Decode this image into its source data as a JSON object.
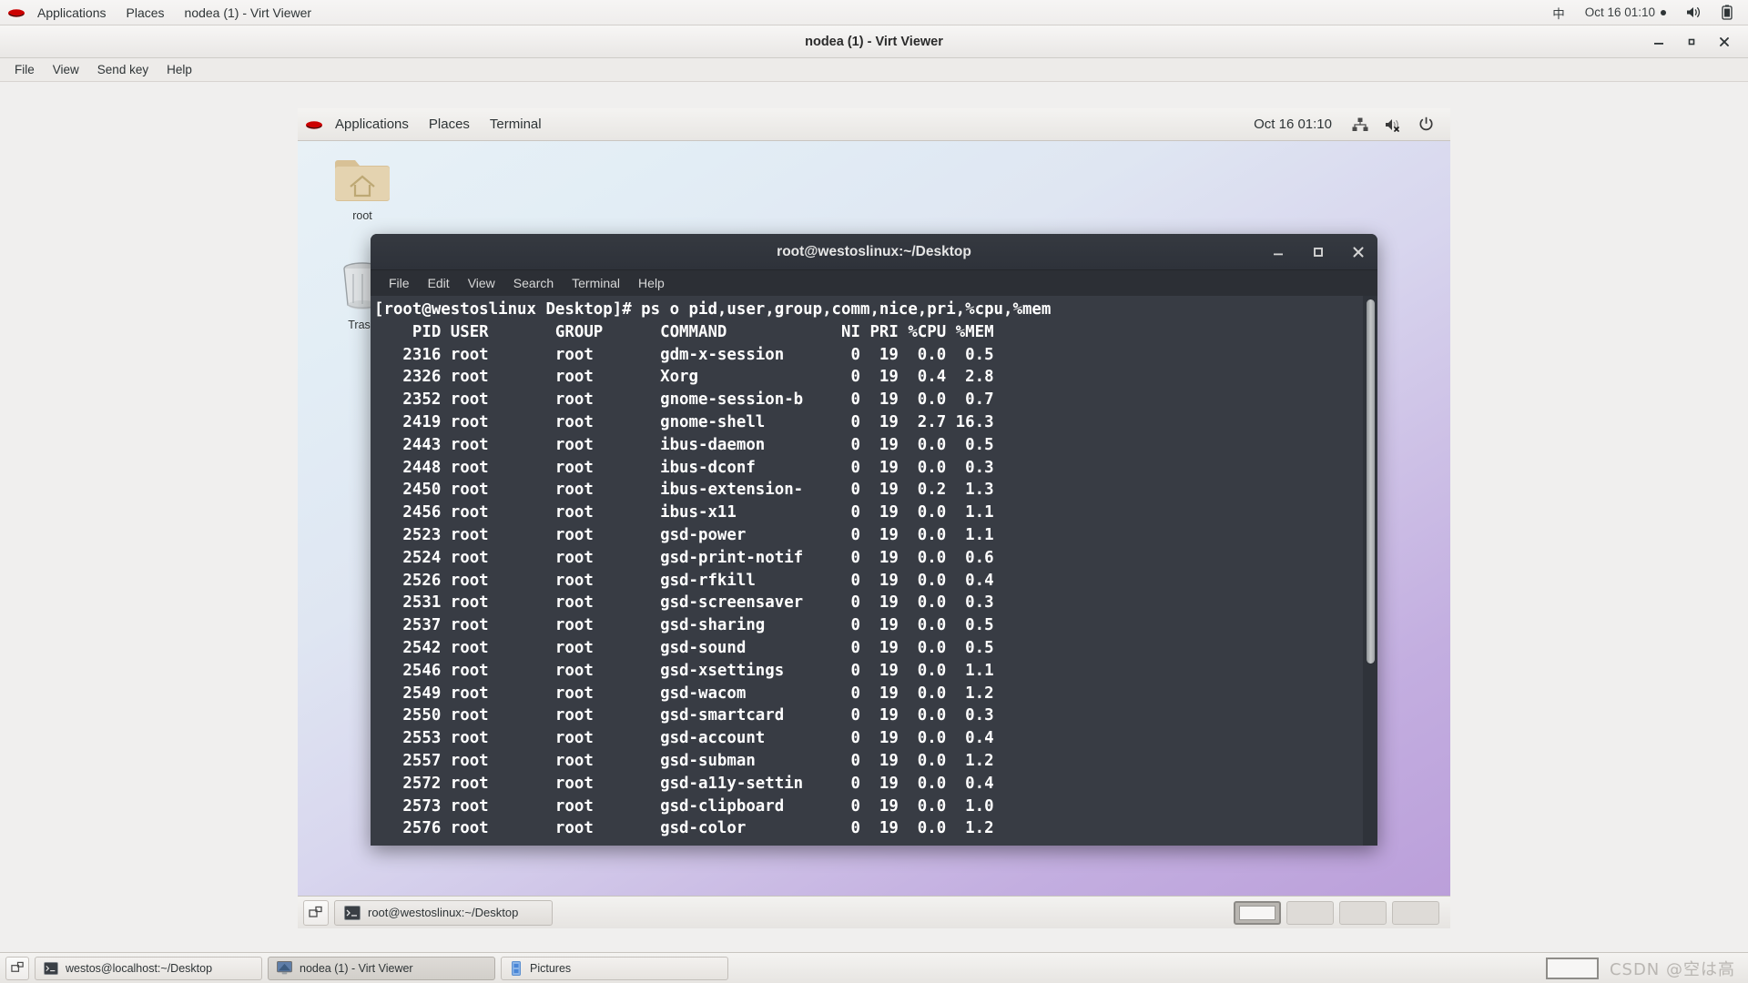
{
  "host_panel": {
    "logo": "redhat-logo",
    "menus": [
      {
        "label": "Applications"
      },
      {
        "label": "Places"
      },
      {
        "label": "nodea (1) - Virt Viewer"
      }
    ],
    "input_method": "中",
    "clock": "Oct 16  01:10",
    "volume_icon": "volume-icon",
    "battery_icon": "battery-icon"
  },
  "virt_viewer": {
    "title": "nodea (1) - Virt Viewer",
    "menus": [
      {
        "label": "File"
      },
      {
        "label": "View"
      },
      {
        "label": "Send key"
      },
      {
        "label": "Help"
      }
    ],
    "window_controls": {
      "minimize": "minimize-icon",
      "maximize": "maximize-icon",
      "close": "close-icon"
    }
  },
  "vm_panel": {
    "logo": "redhat-logo",
    "menus": [
      {
        "label": "Applications"
      },
      {
        "label": "Places"
      },
      {
        "label": "Terminal"
      }
    ],
    "clock": "Oct 16  01:10",
    "network_icon": "network-icon",
    "volume_icon": "volume-muted-icon",
    "power_icon": "power-icon"
  },
  "desktop_icons": [
    {
      "label": "root",
      "icon": "home-folder-icon"
    },
    {
      "label": "Trash",
      "icon": "trash-icon"
    }
  ],
  "terminal": {
    "title": "root@westoslinux:~/Desktop",
    "menus": [
      {
        "label": "File"
      },
      {
        "label": "Edit"
      },
      {
        "label": "View"
      },
      {
        "label": "Search"
      },
      {
        "label": "Terminal"
      },
      {
        "label": "Help"
      }
    ],
    "window_controls": {
      "minimize": "minimize-icon",
      "maximize": "maximize-icon",
      "close": "close-icon"
    },
    "prompt": "[root@westoslinux Desktop]#",
    "command": "ps o pid,user,group,comm,nice,pri,%cpu,%mem",
    "columns": [
      "PID",
      "USER",
      "GROUP",
      "COMMAND",
      "NI",
      "PRI",
      "%CPU",
      "%MEM"
    ],
    "rows": [
      {
        "pid": "2316",
        "user": "root",
        "group": "root",
        "command": "gdm-x-session",
        "ni": "0",
        "pri": "19",
        "cpu": "0.0",
        "mem": "0.5"
      },
      {
        "pid": "2326",
        "user": "root",
        "group": "root",
        "command": "Xorg",
        "ni": "0",
        "pri": "19",
        "cpu": "0.4",
        "mem": "2.8"
      },
      {
        "pid": "2352",
        "user": "root",
        "group": "root",
        "command": "gnome-session-b",
        "ni": "0",
        "pri": "19",
        "cpu": "0.0",
        "mem": "0.7"
      },
      {
        "pid": "2419",
        "user": "root",
        "group": "root",
        "command": "gnome-shell",
        "ni": "0",
        "pri": "19",
        "cpu": "2.7",
        "mem": "16.3"
      },
      {
        "pid": "2443",
        "user": "root",
        "group": "root",
        "command": "ibus-daemon",
        "ni": "0",
        "pri": "19",
        "cpu": "0.0",
        "mem": "0.5"
      },
      {
        "pid": "2448",
        "user": "root",
        "group": "root",
        "command": "ibus-dconf",
        "ni": "0",
        "pri": "19",
        "cpu": "0.0",
        "mem": "0.3"
      },
      {
        "pid": "2450",
        "user": "root",
        "group": "root",
        "command": "ibus-extension-",
        "ni": "0",
        "pri": "19",
        "cpu": "0.2",
        "mem": "1.3"
      },
      {
        "pid": "2456",
        "user": "root",
        "group": "root",
        "command": "ibus-x11",
        "ni": "0",
        "pri": "19",
        "cpu": "0.0",
        "mem": "1.1"
      },
      {
        "pid": "2523",
        "user": "root",
        "group": "root",
        "command": "gsd-power",
        "ni": "0",
        "pri": "19",
        "cpu": "0.0",
        "mem": "1.1"
      },
      {
        "pid": "2524",
        "user": "root",
        "group": "root",
        "command": "gsd-print-notif",
        "ni": "0",
        "pri": "19",
        "cpu": "0.0",
        "mem": "0.6"
      },
      {
        "pid": "2526",
        "user": "root",
        "group": "root",
        "command": "gsd-rfkill",
        "ni": "0",
        "pri": "19",
        "cpu": "0.0",
        "mem": "0.4"
      },
      {
        "pid": "2531",
        "user": "root",
        "group": "root",
        "command": "gsd-screensaver",
        "ni": "0",
        "pri": "19",
        "cpu": "0.0",
        "mem": "0.3"
      },
      {
        "pid": "2537",
        "user": "root",
        "group": "root",
        "command": "gsd-sharing",
        "ni": "0",
        "pri": "19",
        "cpu": "0.0",
        "mem": "0.5"
      },
      {
        "pid": "2542",
        "user": "root",
        "group": "root",
        "command": "gsd-sound",
        "ni": "0",
        "pri": "19",
        "cpu": "0.0",
        "mem": "0.5"
      },
      {
        "pid": "2546",
        "user": "root",
        "group": "root",
        "command": "gsd-xsettings",
        "ni": "0",
        "pri": "19",
        "cpu": "0.0",
        "mem": "1.1"
      },
      {
        "pid": "2549",
        "user": "root",
        "group": "root",
        "command": "gsd-wacom",
        "ni": "0",
        "pri": "19",
        "cpu": "0.0",
        "mem": "1.2"
      },
      {
        "pid": "2550",
        "user": "root",
        "group": "root",
        "command": "gsd-smartcard",
        "ni": "0",
        "pri": "19",
        "cpu": "0.0",
        "mem": "0.3"
      },
      {
        "pid": "2553",
        "user": "root",
        "group": "root",
        "command": "gsd-account",
        "ni": "0",
        "pri": "19",
        "cpu": "0.0",
        "mem": "0.4"
      },
      {
        "pid": "2557",
        "user": "root",
        "group": "root",
        "command": "gsd-subman",
        "ni": "0",
        "pri": "19",
        "cpu": "0.0",
        "mem": "1.2"
      },
      {
        "pid": "2572",
        "user": "root",
        "group": "root",
        "command": "gsd-a11y-settin",
        "ni": "0",
        "pri": "19",
        "cpu": "0.0",
        "mem": "0.4"
      },
      {
        "pid": "2573",
        "user": "root",
        "group": "root",
        "command": "gsd-clipboard",
        "ni": "0",
        "pri": "19",
        "cpu": "0.0",
        "mem": "1.0"
      },
      {
        "pid": "2576",
        "user": "root",
        "group": "root",
        "command": "gsd-color",
        "ni": "0",
        "pri": "19",
        "cpu": "0.0",
        "mem": "1.2"
      }
    ]
  },
  "vm_taskbar": {
    "show_desktop": "show-desktop-icon",
    "tasks": [
      {
        "label": "root@westoslinux:~/Desktop",
        "icon": "terminal-icon"
      }
    ],
    "workspaces": [
      {
        "active": true
      },
      {
        "active": false
      },
      {
        "active": false
      },
      {
        "active": false
      }
    ]
  },
  "host_taskbar": {
    "show_desktop": "show-desktop-icon",
    "tasks": [
      {
        "label": "westos@localhost:~/Desktop",
        "icon": "terminal-icon",
        "active": false
      },
      {
        "label": "nodea (1) - Virt Viewer",
        "icon": "display-icon",
        "active": true
      },
      {
        "label": "Pictures",
        "icon": "folder-icon",
        "active": false
      }
    ],
    "watermark": "CSDN @空は高"
  },
  "colors": {
    "terminal_bg": "#383c44",
    "terminal_chrome": "#2c2f35",
    "terminal_text": "#ffffff",
    "panel_bg": "#f0efee",
    "desktop_gradient_start": "#e8f1f6",
    "desktop_gradient_end": "#bb9fda",
    "redhat_red": "#cc0000"
  }
}
